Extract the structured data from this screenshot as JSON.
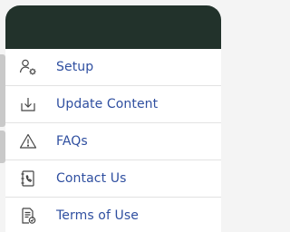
{
  "menu": {
    "items": [
      {
        "label": "Setup",
        "icon": "user-gear-icon"
      },
      {
        "label": "Update Content",
        "icon": "download-icon"
      },
      {
        "label": "FAQs",
        "icon": "warning-icon"
      },
      {
        "label": "Contact Us",
        "icon": "phone-book-icon"
      },
      {
        "label": "Terms of Use",
        "icon": "document-check-icon"
      }
    ]
  },
  "colors": {
    "header": "#22322b",
    "link": "#2f4fa0",
    "icon": "#444444",
    "divider": "#e2e2e2"
  }
}
